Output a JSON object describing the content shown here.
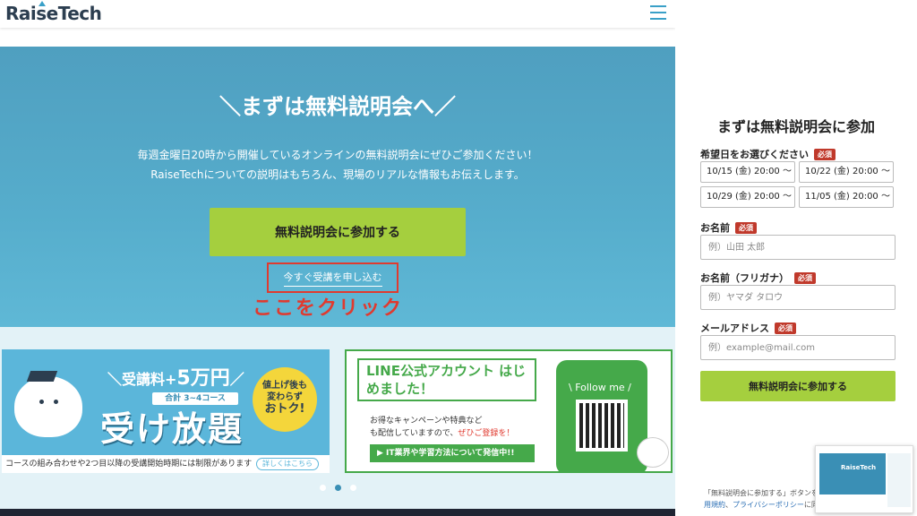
{
  "header": {
    "logo": "RaiseTech"
  },
  "hero": {
    "title": "＼まずは無料説明会へ／",
    "desc1": "毎週金曜日20時から開催しているオンラインの無料説明会にぜひご参加ください！",
    "desc2": "RaiseTechについての説明はもちろん、現場のリアルな情報もお伝えします。",
    "cta_label": "無料説明会に参加する",
    "apply_link": "今すぐ受講を申し込む",
    "click_note": "ここをクリック"
  },
  "banners": {
    "b1": {
      "price": "＼受講料+",
      "price_big": "5万円",
      "price_tail": "／",
      "pill": "合計 3~4コース",
      "big": "受け放題",
      "badge_line1": "値上げ後も",
      "badge_line2": "変わらず",
      "badge_line3": "おトク!",
      "foot": "コースの組み合わせや2つ目以降の受講開始時期には制限があります",
      "more": "詳しくはこちら"
    },
    "b2": {
      "title": "LINE公式アカウント はじめました！",
      "txt1": "お得なキャンペーンや特典など",
      "txt2_a": "も配信していますので、",
      "txt2_b": "ぜひご登録を！",
      "pill": "▶ IT業界や学習方法について発信中!!",
      "follow": "\\ Follow me /"
    }
  },
  "form": {
    "title": "まずは無料説明会に参加",
    "date_label": "希望日をお選びください",
    "required": "必須",
    "dates": [
      "10/15 (金) 20:00 〜",
      "10/22 (金) 20:00 〜",
      "10/29 (金) 20:00 〜",
      "11/05 (金) 20:00 〜"
    ],
    "name_label": "お名前",
    "name_placeholder": "例）山田 太郎",
    "kana_label": "お名前（フリガナ）",
    "kana_placeholder": "例）ヤマダ タロウ",
    "email_label": "メールアドレス",
    "email_placeholder": "例）example@mail.com",
    "submit": "無料説明会に参加する",
    "terms1": "「無料説明会に参加する」ボタンを",
    "terms2a": "用規約",
    "terms2b": "、",
    "terms2c": "プライバシーポリシー",
    "terms2d": "に同意",
    "thumb_logo": "RaiseTech"
  }
}
